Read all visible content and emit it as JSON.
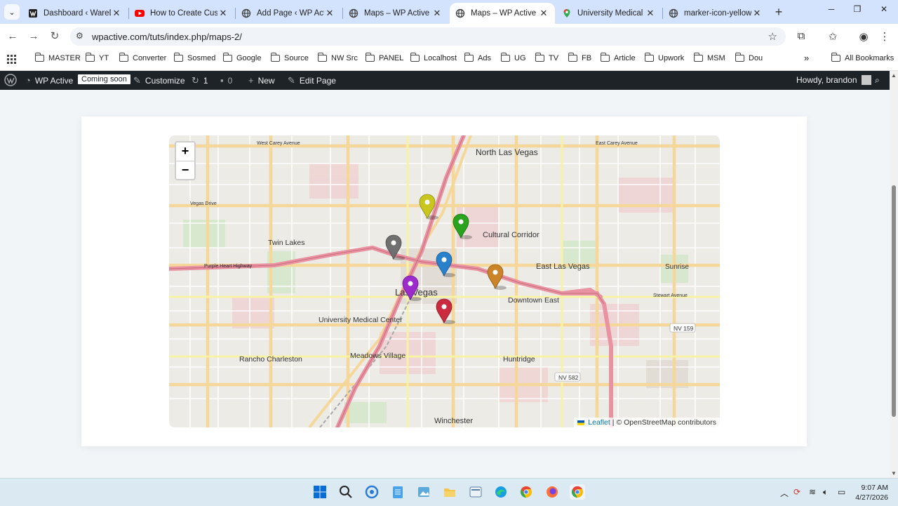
{
  "browser": {
    "tabs": [
      {
        "title": "Dashboard ‹ WareData",
        "favicon": "wordpress-dark-icon",
        "active": false
      },
      {
        "title": "How to Create Custom",
        "favicon": "youtube-icon",
        "active": false
      },
      {
        "title": "Add Page ‹ WP Active",
        "favicon": "globe-icon",
        "active": false
      },
      {
        "title": "Maps – WP Active",
        "favicon": "globe-icon",
        "active": false
      },
      {
        "title": "Maps – WP Active",
        "favicon": "globe-icon",
        "active": true
      },
      {
        "title": "University Medical C",
        "favicon": "google-maps-icon",
        "active": false
      },
      {
        "title": "marker-icon-yellow.p",
        "favicon": "globe-icon",
        "active": false
      }
    ],
    "url": "wpactive.com/tuts/index.php/maps-2/",
    "bookmarks": [
      "MASTER",
      "YT",
      "Converter",
      "Sosmed",
      "Google",
      "Source",
      "NW Src",
      "PANEL",
      "Localhost",
      "Ads",
      "UG",
      "TV",
      "FB",
      "Article",
      "Upwork",
      "MSM",
      "Dou"
    ],
    "all_bookmarks": "All Bookmarks",
    "more": "»"
  },
  "adminbar": {
    "site": "WP Active",
    "coming_soon": "Coming soon",
    "customize": "Customize",
    "updates": "1",
    "comments": "0",
    "new": "New",
    "edit": "Edit Page",
    "howdy": "Howdy, brandon"
  },
  "map": {
    "zoom_in": "+",
    "zoom_out": "−",
    "attribution_link": "Leaflet",
    "attribution_text": "| © OpenStreetMap contributors",
    "labels": [
      "North Las Vegas",
      "Cultural Corridor",
      "Twin Lakes",
      "East Las Vegas",
      "Sunrise",
      "Las Vegas",
      "Downtown East",
      "University Medical Center",
      "Rancho Charleston",
      "Meadows Village",
      "Huntridge",
      "Winchester",
      "NV 159",
      "NV 582",
      "West Carey Avenue",
      "East Carey Avenue",
      "Vegas Drive",
      "Purple Heart Highway",
      "Stewart Avenue"
    ],
    "markers": [
      {
        "color": "yellow",
        "hex": "#c8c61f"
      },
      {
        "color": "green",
        "hex": "#2aa31f"
      },
      {
        "color": "grey",
        "hex": "#707070"
      },
      {
        "color": "blue",
        "hex": "#2a81cb"
      },
      {
        "color": "orange",
        "hex": "#cb8427"
      },
      {
        "color": "violet",
        "hex": "#9c2bcb"
      },
      {
        "color": "red",
        "hex": "#cb2b3e"
      }
    ]
  },
  "taskbar": {
    "time": "9:07 AM",
    "date": "4/27/2026"
  }
}
